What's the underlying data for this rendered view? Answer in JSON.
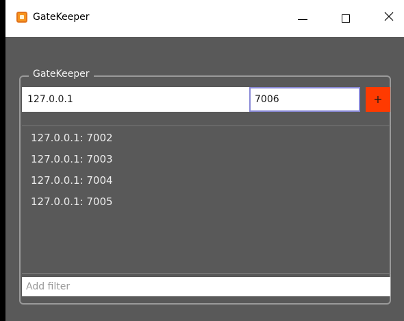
{
  "window": {
    "title": "GateKeeper",
    "icon": "gatekeeper-app-icon"
  },
  "group": {
    "title": "GateKeeper"
  },
  "host_input": {
    "value": "127.0.0.1"
  },
  "port_input": {
    "value": "7006"
  },
  "add_button": {
    "label": "+"
  },
  "entries": [
    "127.0.0.1: 7002",
    "127.0.0.1: 7003",
    "127.0.0.1: 7004",
    "127.0.0.1: 7005"
  ],
  "filter": {
    "placeholder": "Add filter",
    "value": ""
  },
  "colors": {
    "background": "#595959",
    "accent": "#ff3a00",
    "focus_border": "#8a8ad8"
  }
}
